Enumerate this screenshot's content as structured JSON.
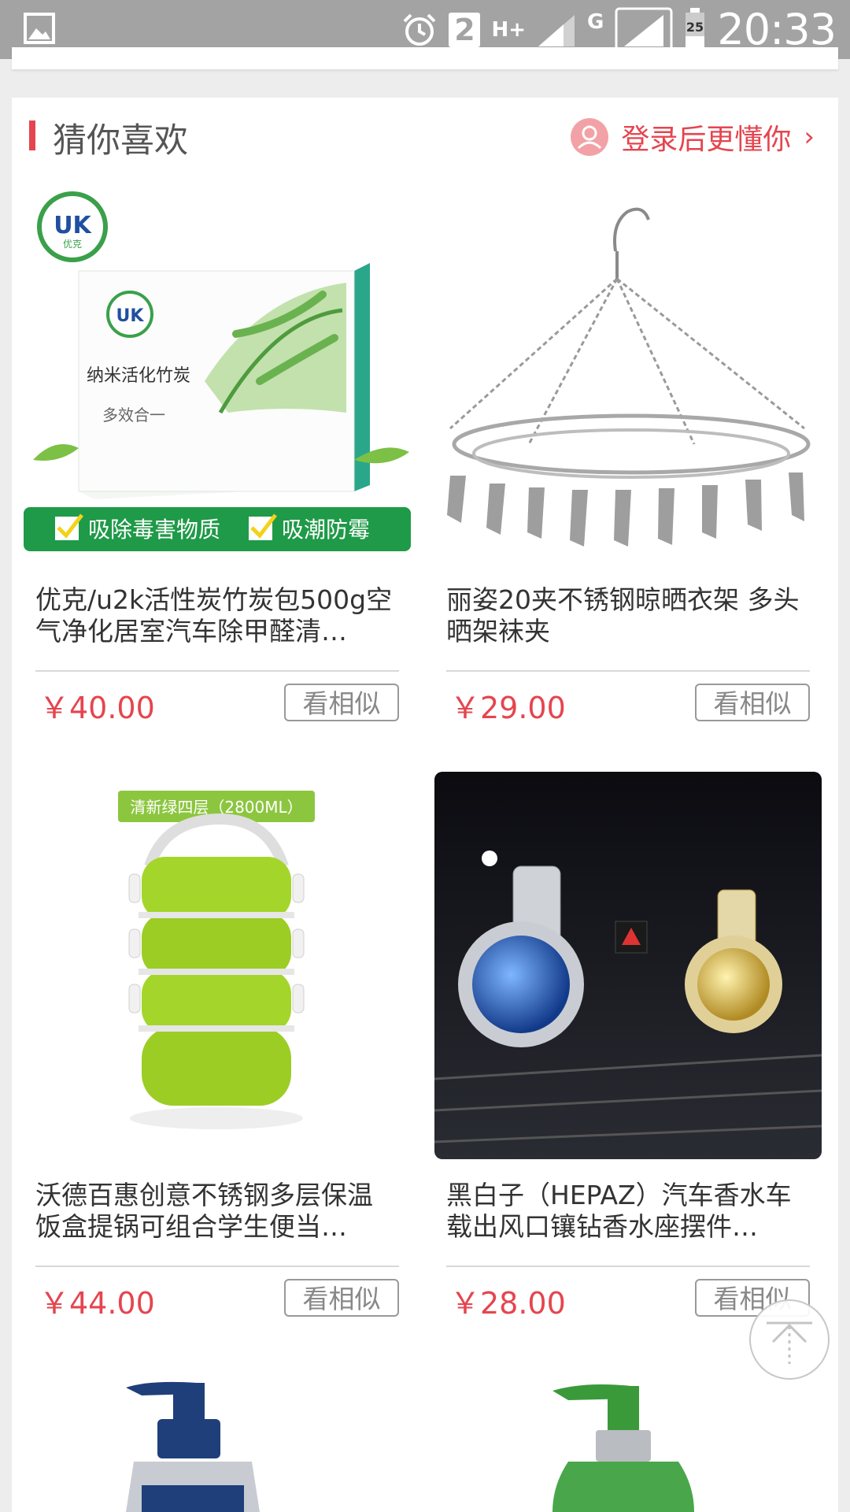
{
  "status_bar": {
    "time": "20:33",
    "sim_badge": "2",
    "network_h": "H+",
    "network_g": "G",
    "battery_level": "25",
    "icons": [
      "gallery-icon",
      "alarm-icon",
      "signal-icon",
      "wifi-signal-icon",
      "battery-icon"
    ]
  },
  "section": {
    "title": "猜你喜欢",
    "login_prompt": "登录后更懂你",
    "accent_color": "#e5454f"
  },
  "products": [
    {
      "title": "优克/u2k活性炭竹炭包500g空气净化居室汽车除甲醛清…",
      "price": "￥40.00",
      "similar_label": "看相似",
      "image": {
        "brand_badge": "UK",
        "brand_sub": "优克",
        "box_text": "纳米活化竹炭",
        "box_side": "多效合一",
        "banner_1": "吸除毒害物质",
        "banner_2": "吸潮防霉"
      }
    },
    {
      "title": "丽姿20夹不锈钢晾晒衣架 多头晒架袜夹",
      "price": "￥29.00",
      "similar_label": "看相似",
      "image": {
        "icon": "clothes-hanger-icon"
      }
    },
    {
      "title": "沃德百惠创意不锈钢多层保温饭盒提锅可组合学生便当…",
      "price": "￥44.00",
      "similar_label": "看相似",
      "image": {
        "tag": "清新绿四层（2800ML）"
      }
    },
    {
      "title": "黑白子（HEPAZ）汽车香水车载出风口镶钻香水座摆件…",
      "price": "￥28.00",
      "similar_label": "看相似",
      "image": {
        "icon": "car-perfume-icon"
      }
    }
  ],
  "partial_products": [
    {
      "image": {
        "icon": "pump-bottle-icon",
        "cap_color": "#1e3f7a"
      }
    },
    {
      "image": {
        "icon": "pump-bottle-icon",
        "cap_color": "#3a9a3a"
      }
    }
  ],
  "back_to_top": {
    "icon": "arrow-up-icon"
  }
}
